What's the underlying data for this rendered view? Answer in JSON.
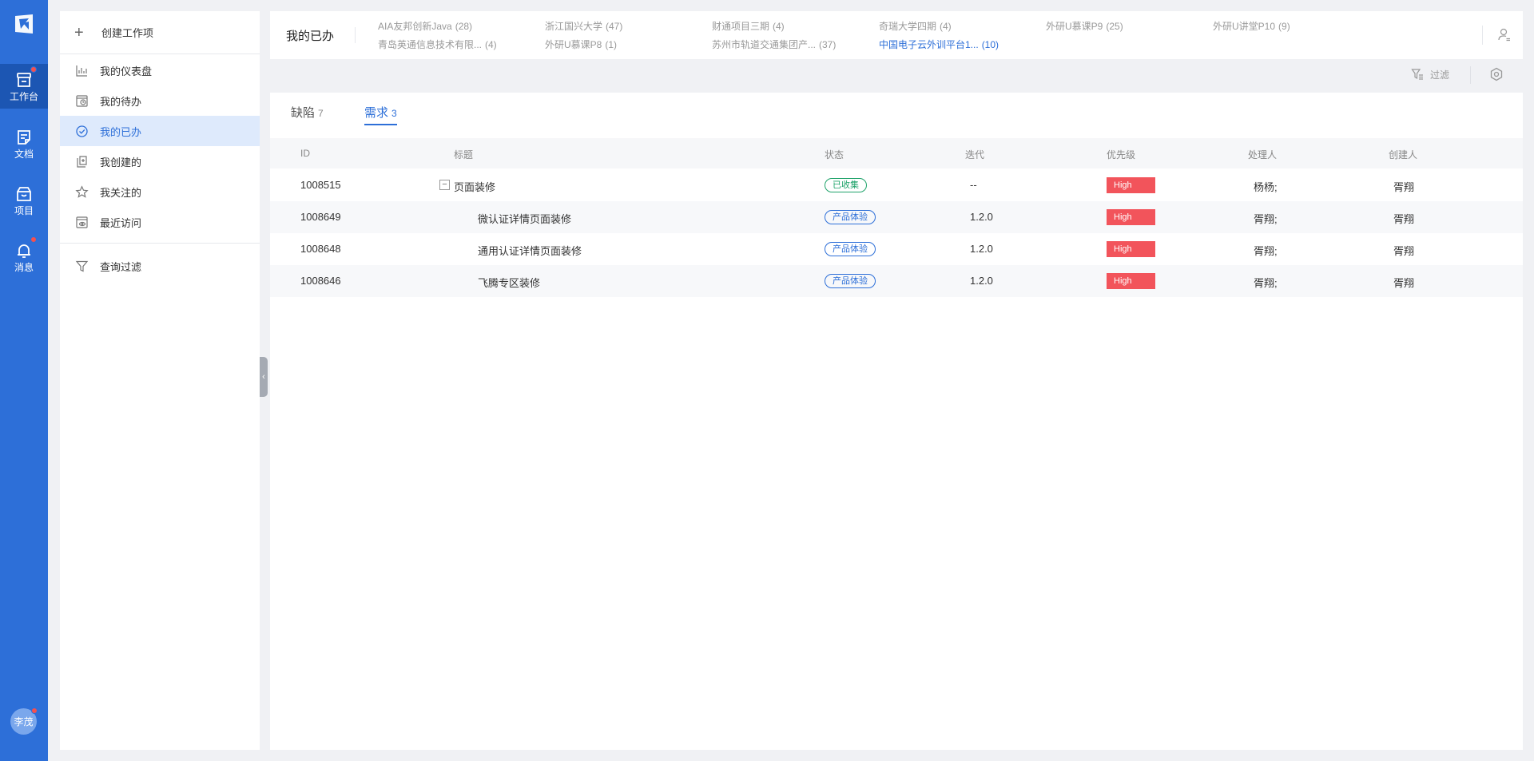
{
  "rail": {
    "items": [
      {
        "label": "工作台",
        "icon": "workbench-icon"
      },
      {
        "label": "文档",
        "icon": "document-icon"
      },
      {
        "label": "项目",
        "icon": "project-icon"
      },
      {
        "label": "消息",
        "icon": "bell-icon"
      }
    ],
    "avatar_text": "李茂",
    "badge_color": "#f5504f",
    "accent_color": "#2d6fd8"
  },
  "sidebar": {
    "create_label": "创建工作项",
    "items": [
      {
        "label": "我的仪表盘",
        "icon": "dashboard-icon"
      },
      {
        "label": "我的待办",
        "icon": "todo-icon"
      },
      {
        "label": "我的已办",
        "icon": "done-check-icon"
      },
      {
        "label": "我创建的",
        "icon": "created-icon"
      },
      {
        "label": "我关注的",
        "icon": "star-icon"
      },
      {
        "label": "最近访问",
        "icon": "recent-visit-icon"
      },
      {
        "label": "查询过滤",
        "icon": "filter-icon"
      }
    ]
  },
  "topbar": {
    "title": "我的已办",
    "projects": [
      {
        "name": "AIA友邦创新Java",
        "count": "(28)"
      },
      {
        "name": "浙江国兴大学",
        "count": "(47)"
      },
      {
        "name": "财通项目三期",
        "count": "(4)"
      },
      {
        "name": "奇瑞大学四期",
        "count": "(4)"
      },
      {
        "name": "外研U慕课P9",
        "count": "(25)"
      },
      {
        "name": "外研U讲堂P10",
        "count": "(9)"
      },
      {
        "name": "青岛英通信息技术有限...",
        "count": "(4)"
      },
      {
        "name": "外研U慕课P8",
        "count": "(1)"
      },
      {
        "name": "苏州市轨道交通集团产...",
        "count": "(37)"
      },
      {
        "name": "中国电子云外训平台1...",
        "count": "(10)"
      }
    ]
  },
  "toolbar": {
    "filter_label": "过滤"
  },
  "tabs": [
    {
      "label": "缺陷",
      "count": "7"
    },
    {
      "label": "需求",
      "count": "3"
    }
  ],
  "table": {
    "columns": [
      "ID",
      "标题",
      "状态",
      "迭代",
      "优先级",
      "处理人",
      "创建人"
    ],
    "rows": [
      {
        "id": "1008515",
        "title": "页面装修",
        "status": "已收集",
        "iteration": "--",
        "priority": "High",
        "handler": "杨杨;",
        "creator": "胥翔"
      },
      {
        "id": "1008649",
        "title": "微认证详情页面装修",
        "status": "产品体验",
        "iteration": "1.2.0",
        "priority": "High",
        "handler": "胥翔;",
        "creator": "胥翔"
      },
      {
        "id": "1008648",
        "title": "通用认证详情页面装修",
        "status": "产品体验",
        "iteration": "1.2.0",
        "priority": "High",
        "handler": "胥翔;",
        "creator": "胥翔"
      },
      {
        "id": "1008646",
        "title": "飞腾专区装修",
        "status": "产品体验",
        "iteration": "1.2.0",
        "priority": "High",
        "handler": "胥翔;",
        "creator": "胥翔"
      }
    ],
    "expand_symbol": "−",
    "status_colors": {
      "已收集": "#1ea36a",
      "产品体验": "#2d6fd8"
    },
    "priority_color": "#f2545b"
  }
}
